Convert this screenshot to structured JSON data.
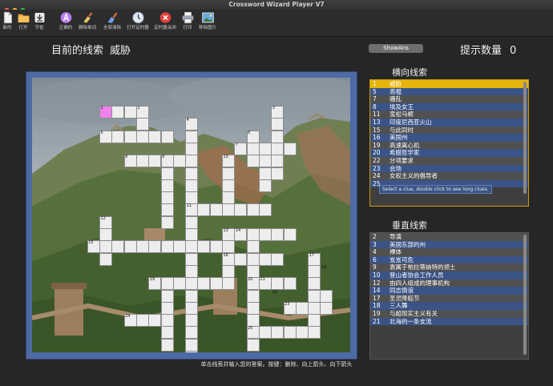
{
  "window": {
    "title": "Crossword Wizard Player V7"
  },
  "toolbar": [
    {
      "id": "new",
      "label": "新的",
      "icon": "new-document-icon"
    },
    {
      "id": "open",
      "label": "打开",
      "icon": "folder-icon"
    },
    {
      "id": "save",
      "label": "节省",
      "icon": "download-icon"
    },
    {
      "id": "correct",
      "label": "正确的",
      "icon": "letter-a-icon"
    },
    {
      "id": "delete-word",
      "label": "删除单词",
      "icon": "clear-brush-icon"
    },
    {
      "id": "clear-all",
      "label": "全部清除",
      "icon": "brush-icon"
    },
    {
      "id": "start-timer",
      "label": "打开定时器",
      "icon": "clock-icon"
    },
    {
      "id": "stop-timer",
      "label": "定时器关闭",
      "icon": "stop-icon"
    },
    {
      "id": "print",
      "label": "打印",
      "icon": "printer-icon"
    },
    {
      "id": "remove-image",
      "label": "移除图片",
      "icon": "image-icon"
    }
  ],
  "current_clue": {
    "label": "目前的线索",
    "value": "威胁"
  },
  "show_answer_label": "ShowAns",
  "hint": {
    "label": "提示数量",
    "value": "0"
  },
  "across": {
    "title": "横向线索",
    "items": [
      {
        "num": "1",
        "text": "威胁"
      },
      {
        "num": "5",
        "text": "恶棍"
      },
      {
        "num": "7",
        "text": "骚乱"
      },
      {
        "num": "8",
        "text": "埃及女王"
      },
      {
        "num": "11",
        "text": "宽松马裤"
      },
      {
        "num": "13",
        "text": "印度尼西亚火山"
      },
      {
        "num": "15",
        "text": "与此同时"
      },
      {
        "num": "16",
        "text": "美国州"
      },
      {
        "num": "19",
        "text": "高速离心机"
      },
      {
        "num": "20",
        "text": "希腊哲学家"
      },
      {
        "num": "22",
        "text": "分项要求"
      },
      {
        "num": "23",
        "text": "会场"
      },
      {
        "num": "24",
        "text": "女权主义的倡导者"
      },
      {
        "num": "25",
        "text": ""
      }
    ]
  },
  "tooltip": "Select a clue, double click to see long clues.",
  "down": {
    "title": "垂直线索",
    "items": [
      {
        "num": "2",
        "text": "导演"
      },
      {
        "num": "3",
        "text": "美国东部的州"
      },
      {
        "num": "4",
        "text": "裸体"
      },
      {
        "num": "6",
        "text": "岌岌可危"
      },
      {
        "num": "9",
        "text": "袁属于帕拉蒂纳特的领土"
      },
      {
        "num": "10",
        "text": "登山者协会工作人员"
      },
      {
        "num": "12",
        "text": "由四人组成的理事机构"
      },
      {
        "num": "14",
        "text": "同志情谊"
      },
      {
        "num": "17",
        "text": "圣灵降临节"
      },
      {
        "num": "18",
        "text": "三人舞"
      },
      {
        "num": "19",
        "text": "与超现实主义有关"
      },
      {
        "num": "21",
        "text": "北海的一条支流"
      }
    ]
  },
  "status": "单击线索并输入您的答案。按键：删除、向上箭头、向下箭头",
  "grid_numbers": [
    "1",
    "2",
    "3",
    "4",
    "5",
    "6",
    "7",
    "8",
    "9",
    "10",
    "11",
    "12",
    "13",
    "14",
    "15",
    "16",
    "17",
    "18",
    "19",
    "20",
    "21",
    "22",
    "23",
    "24",
    "25"
  ],
  "colors": {
    "selected_row": "#e6b40c",
    "row_blue": "#3a5488",
    "row_grey": "#505050",
    "highlight_cell": "#ee82ee",
    "board_frame": "#4d6aa4"
  }
}
